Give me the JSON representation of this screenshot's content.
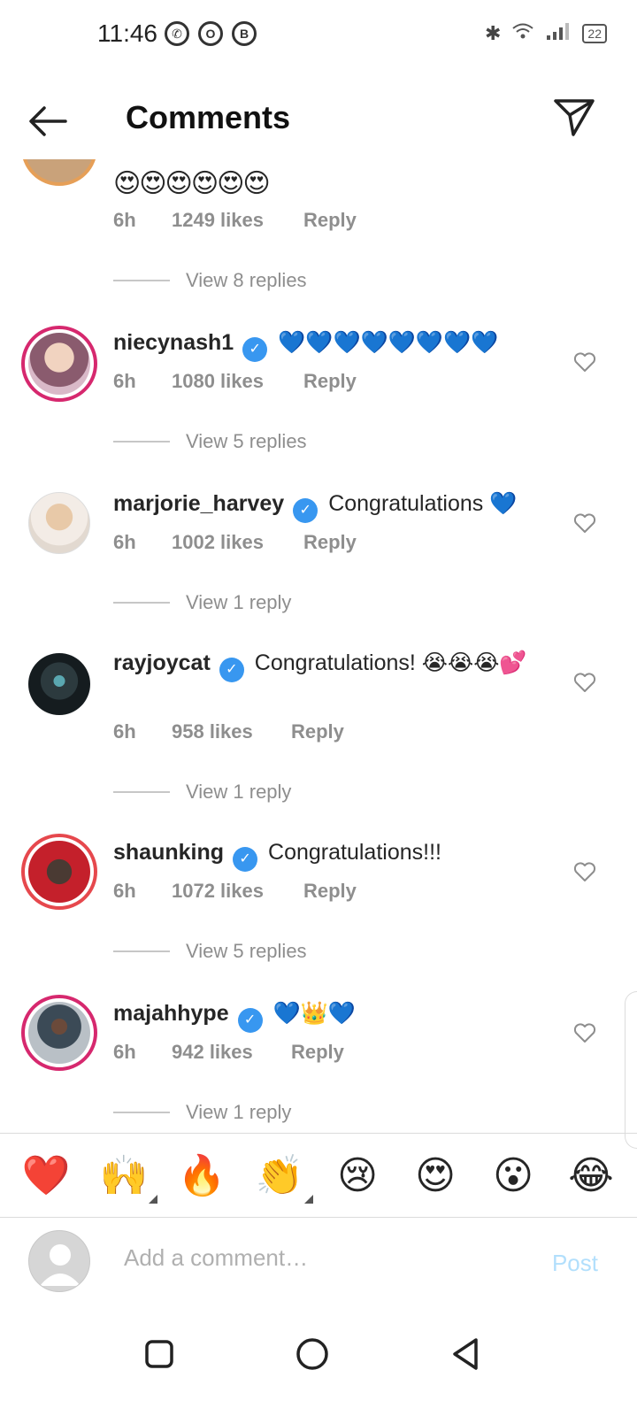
{
  "status_bar": {
    "time": "11:46",
    "battery": "22"
  },
  "header": {
    "title": "Comments"
  },
  "partial_comment": {
    "text": "😍😍😍😍😍😍",
    "time": "6h",
    "likes": "1249 likes",
    "reply": "Reply",
    "view_replies": "View 8 replies"
  },
  "comments": [
    {
      "username": "niecynash1",
      "text": "💙💙💙💙💙💙💙💙",
      "time": "6h",
      "likes": "1080 likes",
      "reply": "Reply",
      "view_replies": "View 5 replies"
    },
    {
      "username": "marjorie_harvey",
      "text": "Congratulations 💙",
      "time": "6h",
      "likes": "1002 likes",
      "reply": "Reply",
      "view_replies": "View 1 reply"
    },
    {
      "username": "rayjoycat",
      "text": "Congratulations! 😭😭😭💕",
      "time": "6h",
      "likes": "958 likes",
      "reply": "Reply",
      "view_replies": "View 1 reply"
    },
    {
      "username": "shaunking",
      "text": "Congratulations!!!",
      "time": "6h",
      "likes": "1072 likes",
      "reply": "Reply",
      "view_replies": "View 5 replies"
    },
    {
      "username": "majahhype",
      "text": "💙👑💙",
      "time": "6h",
      "likes": "942 likes",
      "reply": "Reply",
      "view_replies": "View 1 reply"
    }
  ],
  "emoji_bar": [
    "❤️",
    "🙌",
    "🔥",
    "👏",
    "😢",
    "😍",
    "😮",
    "😂"
  ],
  "composer": {
    "placeholder": "Add a comment…",
    "post": "Post"
  },
  "colors": {
    "accent": "#3897f0",
    "ring": "#d6286e",
    "muted": "#8e8e8e",
    "post_disabled": "#b2dffc"
  }
}
